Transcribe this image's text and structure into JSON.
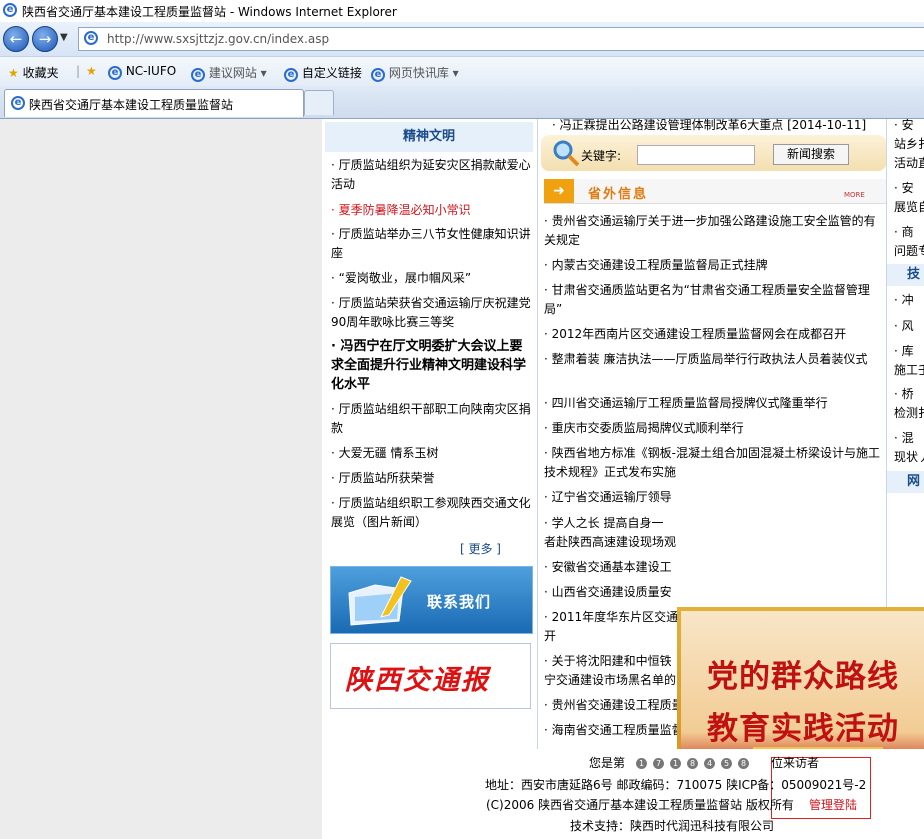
{
  "window": {
    "title": "陕西省交通厅基本建设工程质量监督站 - Windows Internet Explorer"
  },
  "address": {
    "url": "http://www.sxsjttzjz.gov.cn/index.asp"
  },
  "favorites_bar": {
    "favorites": "收藏夹",
    "items": [
      "NC-IUFO",
      "建议网站 ▾",
      "自定义链接",
      "网页快讯库 ▾"
    ]
  },
  "tab": {
    "title": "陕西省交通厅基本建设工程质量监督站"
  },
  "left": {
    "heading": "精神文明",
    "items": [
      "· 厅质监站组织为延安灾区捐款献爱心活动",
      "· 夏季防暑降温必知小常识",
      "· 厅质监站举办三八节女性健康知识讲座",
      "· “爱岗敬业，展巾帼风采”",
      "· 厅质监站荣获省交通运输厅庆祝建党90周年歌咏比赛三等奖",
      "· 冯西宁在厅文明委扩大会议上要求全面提升行业精神文明建设科学化水平",
      "· 厅质监站组织干部职工向陕南灾区捐款",
      "· 大爱无疆 情系玉树",
      "· 厅质监站所获荣誉",
      "· 厅质监站组织职工参观陕西交通文化展览（图片新闻）"
    ],
    "more": "[ 更多 ]",
    "contact": "联系我们",
    "newspaper": "陕西交通报"
  },
  "middle": {
    "top_link": "· 冯正霖提出公路建设管理体制改革6大重点   [2014-10-11]",
    "search_label": "关键字:",
    "search_value": "",
    "search_button": "新闻搜索",
    "section_title": "省外信息",
    "section_more": "MORE",
    "items": [
      "· 贵州省交通运输厅关于进一步加强公路建设施工安全监管的有关规定",
      "· 内蒙古交通建设工程质量监督局正式挂牌",
      "· 甘肃省交通质监站更名为“甘肃省交通工程质量安全监督管理局”",
      "· 2012年西南片区交通建设工程质量监督网会在成都召开",
      "· 整肃着装 廉洁执法——厅质监局举行行政执法人员着装仪式",
      "· 四川省交通运输厅工程质量监督局授牌仪式隆重举行",
      "· 重庆市交委质监局揭牌仪式顺利举行",
      "· 陕西省地方标准《钢板-混凝土组合加固混凝土桥梁设计与施工技术规程》正式发布实施",
      "· 辽宁省交通运输厅领导",
      "· 学人之长 提高自身一",
      "者赴陕西高速建设现场观",
      "· 安徽省交通基本建设工",
      "· 山西省交通建设质量安",
      "· 2011年度华东片区交通",
      "开",
      "· 关于将沈阳建和中恒铁",
      "宁交通建设市场黑名单的",
      "· 贵州省交通建设工程质量监督局隆重举行局党委揭牌仪式",
      "· 海南省交通工程质量监督管理局儋州分局正式揭牌成立"
    ]
  },
  "right": {
    "items_a": [
      "· 安",
      "站乡扌",
      "活动直",
      "· 安",
      "展览自",
      "· 商",
      "问题专"
    ],
    "heading_b": "技",
    "items_b": [
      "· 冲",
      "· 风",
      "· 库",
      "施工壬",
      "· 桥",
      "检测扌",
      "· 混",
      "现状丿"
    ],
    "heading_c": "网"
  },
  "banner": {
    "line1": "党的群众路线",
    "line2": "教育实践活动"
  },
  "footer": {
    "visitor_prefix": "您是第",
    "visitor_digits": [
      "1",
      "7",
      "1",
      "8",
      "4",
      "5",
      "8"
    ],
    "visitor_suffix": "位来访者",
    "address": "地址：西安市唐延路6号  邮政编码：710075  陕ICP备：05009021号-2",
    "copyright": "(C)2006 陕西省交通厅基本建设工程质量监督站  版权所有",
    "admin_login": "管理登陆",
    "support": "技术支持：陕西时代润迅科技有限公司"
  }
}
